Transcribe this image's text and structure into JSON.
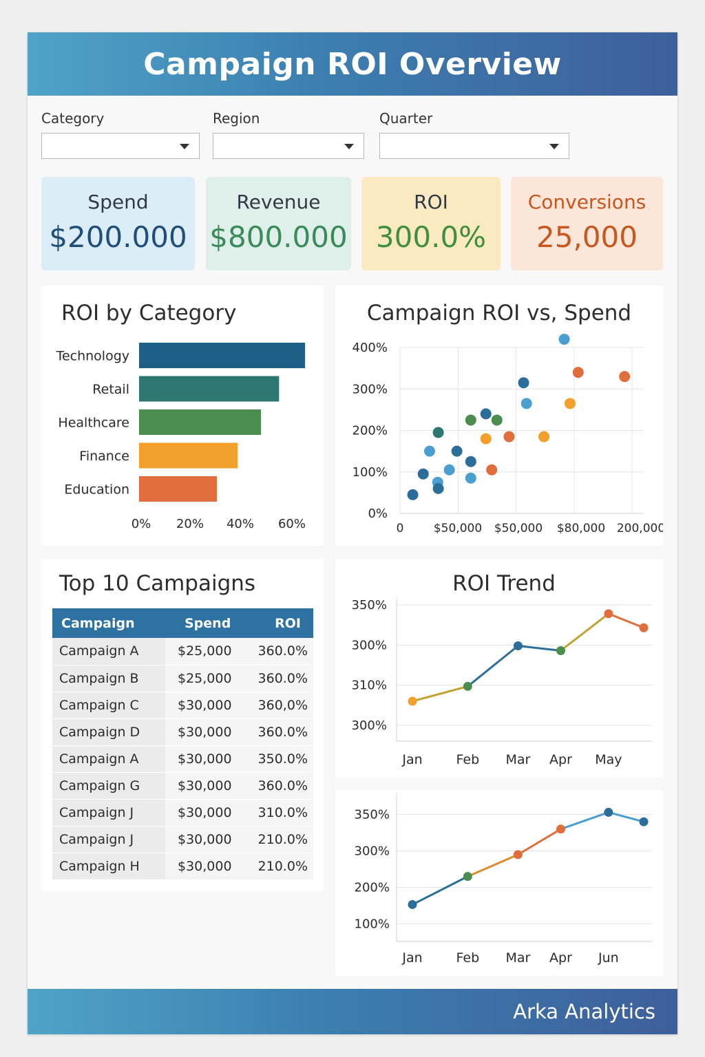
{
  "header": {
    "title": "Campaign ROI Overview"
  },
  "filters": [
    {
      "label": "Category",
      "value": ""
    },
    {
      "label": "Region",
      "value": ""
    },
    {
      "label": "Quarter",
      "value": ""
    }
  ],
  "kpis": [
    {
      "label": "Spend",
      "value": "$200.000",
      "bg": "#dcedf7",
      "label_color": "#2f3a45",
      "value_color": "#1f4e79"
    },
    {
      "label": "Revenue",
      "value": "$800.000",
      "bg": "#dfefea",
      "label_color": "#2f3a45",
      "value_color": "#3a8a5a"
    },
    {
      "label": "ROI",
      "value": "300.0%",
      "bg": "#fbe9c2",
      "label_color": "#2f3a45",
      "value_color": "#3f8f3f"
    },
    {
      "label": "Conversions",
      "value": "25,000",
      "bg": "#fbe6d9",
      "label_color": "#c8561f",
      "value_color": "#c8561f"
    }
  ],
  "roi_by_category": {
    "title": "ROI by Category",
    "chart_data": {
      "type": "bar",
      "orientation": "horizontal",
      "categories": [
        "Technology",
        "Retail",
        "Healthcare",
        "Finance",
        "Education"
      ],
      "values": [
        64,
        54,
        47,
        38,
        30
      ],
      "colors": [
        "#1d5f86",
        "#2d7770",
        "#4a8d4f",
        "#f2a02b",
        "#e06e3c"
      ],
      "xlim": [
        0,
        64
      ],
      "xticks": [
        "0%",
        "20%",
        "40%",
        "60%"
      ],
      "xtick_values": [
        0,
        20,
        40,
        60
      ],
      "xtick_slots": [
        0,
        20,
        40,
        60
      ]
    }
  },
  "roi_vs_spend": {
    "title": "Campaign ROI vs, Spend",
    "chart_data": {
      "type": "scatter",
      "yticks": [
        "0%",
        "100%",
        "200%",
        "300%",
        "400%"
      ],
      "ytick_values": [
        0,
        100,
        200,
        300,
        400
      ],
      "xticks": [
        "0",
        "$50,000",
        "$50,000",
        "$80,000",
        "200,000"
      ],
      "xtick_slots": [
        0,
        1,
        2,
        3,
        4
      ],
      "xlim": [
        0,
        4.2
      ],
      "ylim": [
        0,
        400
      ],
      "points": [
        {
          "x": 0.22,
          "y": 45,
          "c": "#2c6e9a"
        },
        {
          "x": 0.4,
          "y": 95,
          "c": "#2c6e9a"
        },
        {
          "x": 0.51,
          "y": 150,
          "c": "#4a9fd0"
        },
        {
          "x": 0.65,
          "y": 75,
          "c": "#4a9fd0"
        },
        {
          "x": 0.66,
          "y": 195,
          "c": "#2d7770"
        },
        {
          "x": 0.66,
          "y": 60,
          "c": "#2c6e9a"
        },
        {
          "x": 0.85,
          "y": 105,
          "c": "#4a9fd0"
        },
        {
          "x": 0.98,
          "y": 150,
          "c": "#2c6e9a"
        },
        {
          "x": 1.22,
          "y": 125,
          "c": "#2c6e9a"
        },
        {
          "x": 1.22,
          "y": 225,
          "c": "#4a8d4f"
        },
        {
          "x": 1.22,
          "y": 85,
          "c": "#4a9fd0"
        },
        {
          "x": 1.48,
          "y": 240,
          "c": "#2c6e9a"
        },
        {
          "x": 1.48,
          "y": 180,
          "c": "#f2a02b"
        },
        {
          "x": 1.58,
          "y": 105,
          "c": "#e06e3c"
        },
        {
          "x": 1.67,
          "y": 225,
          "c": "#4a8d4f"
        },
        {
          "x": 1.88,
          "y": 185,
          "c": "#e06e3c"
        },
        {
          "x": 2.13,
          "y": 315,
          "c": "#2c6e9a"
        },
        {
          "x": 2.18,
          "y": 265,
          "c": "#4a9fd0"
        },
        {
          "x": 2.48,
          "y": 185,
          "c": "#f2a02b"
        },
        {
          "x": 2.83,
          "y": 420,
          "c": "#4a9fd0"
        },
        {
          "x": 2.93,
          "y": 265,
          "c": "#f2a02b"
        },
        {
          "x": 3.07,
          "y": 340,
          "c": "#e06e3c"
        },
        {
          "x": 3.87,
          "y": 330,
          "c": "#e06e3c"
        }
      ]
    }
  },
  "top_campaigns": {
    "title": "Top 10 Campaigns",
    "columns": [
      "Campaign",
      "Spend",
      "ROI"
    ],
    "rows": [
      [
        "Campaign A",
        "$25,000",
        "360.0%"
      ],
      [
        "Campaign B",
        "$25,000",
        "360.0%"
      ],
      [
        "Campaign C",
        "$30,000",
        "360,0%"
      ],
      [
        "Campaign D",
        "$30,000",
        "360.0%"
      ],
      [
        "Campaign A",
        "$30,000",
        "350.0%"
      ],
      [
        "Campaign G",
        "$30,000",
        "360.0%"
      ],
      [
        "Campaign J",
        "$30,000",
        "310.0%"
      ],
      [
        "Campaign J",
        "$30,000",
        "210.0%"
      ],
      [
        "Campaign H",
        "$30,000",
        "210.0%"
      ]
    ]
  },
  "roi_trend": {
    "title": "ROI Trend",
    "chart_data": {
      "type": "line",
      "categories": [
        "Jan",
        "Feb",
        "Mar",
        "Apr",
        "May"
      ],
      "yticks": [
        "350%",
        "300%",
        "310%",
        "300%"
      ],
      "ytick_slots": [
        4,
        3,
        2,
        1
      ],
      "ylim": [
        0.4,
        4
      ],
      "x": [
        0,
        1.1,
        2.1,
        2.95,
        3.9,
        4.6
      ],
      "values": [
        1.6,
        1.97,
        2.98,
        2.86,
        3.78,
        3.43
      ],
      "point_colors": [
        "#f2a02b",
        "#4a8d4f",
        "#2c6e9a",
        "#4a8d4f",
        "#e06e3c",
        "#e06e3c"
      ],
      "segment_colors": [
        "#c2a12e",
        "#2c6e9a",
        "#2c6e9a",
        "#c2a12e",
        "#e06e3c"
      ],
      "xtick_slots": [
        0,
        1.1,
        2.1,
        2.95,
        3.9
      ]
    }
  },
  "roi_trend_2": {
    "chart_data": {
      "type": "line",
      "categories": [
        "Jan",
        "Feb",
        "Mar",
        "Apr",
        "Jun"
      ],
      "yticks": [
        "350%",
        "300%",
        "200%",
        "100%"
      ],
      "ytick_slots": [
        4,
        3,
        2,
        1
      ],
      "ylim": [
        0.5,
        4.2
      ],
      "x": [
        0,
        1.1,
        2.1,
        2.95,
        3.9,
        4.6
      ],
      "values": [
        1.53,
        2.3,
        2.9,
        3.6,
        4.06,
        3.8
      ],
      "point_colors": [
        "#2c6e9a",
        "#4a8d4f",
        "#e06e3c",
        "#e06e3c",
        "#2c6e9a",
        "#2c6e9a"
      ],
      "segment_colors": [
        "#2c6e9a",
        "#e08a2e",
        "#e06e3c",
        "#4a9fd0",
        "#4a9fd0"
      ],
      "xtick_slots": [
        0,
        1.1,
        2.1,
        2.95,
        3.9
      ]
    }
  },
  "footer": {
    "brand": "Arka Analytics"
  }
}
